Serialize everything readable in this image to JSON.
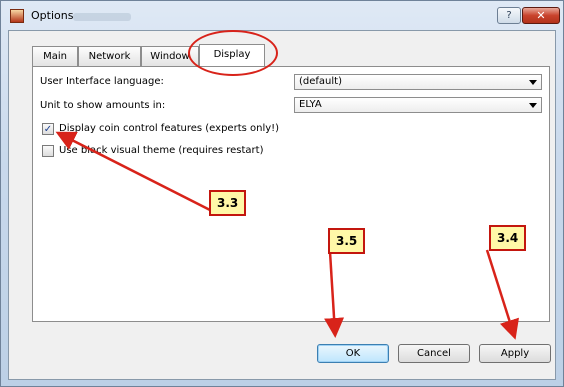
{
  "window": {
    "title": "Options",
    "help_label": "?",
    "close_label": "✕"
  },
  "tabs": [
    {
      "label": "Main"
    },
    {
      "label": "Network"
    },
    {
      "label": "Window"
    },
    {
      "label": "Display",
      "active": true
    }
  ],
  "display": {
    "language_label": "User Interface language:",
    "language_value": "(default)",
    "unit_label": "Unit to show amounts in:",
    "unit_value": "ELYA",
    "coin_control": {
      "label": "Display coin control features (experts only!)",
      "checked": true,
      "mark": "✓"
    },
    "black_theme": {
      "label": "Use black visual theme (requires restart)",
      "checked": false
    }
  },
  "buttons": {
    "ok": "OK",
    "cancel": "Cancel",
    "apply": "Apply"
  },
  "annotations": {
    "callout_checkbox": "3.3",
    "callout_ok": "3.5",
    "callout_apply": "3.4",
    "color": "#d8231a"
  }
}
